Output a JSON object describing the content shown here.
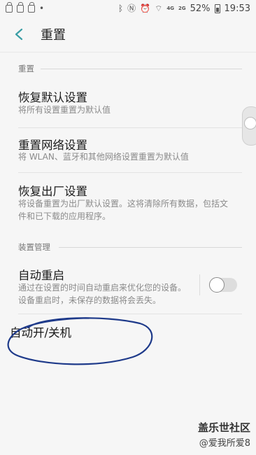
{
  "status_bar": {
    "battery": "52%",
    "time": "19:53",
    "net_a": "4G",
    "net_b": "2G"
  },
  "header": {
    "title": "重置"
  },
  "sections": [
    {
      "label": "重置",
      "items": [
        {
          "title": "恢复默认设置",
          "desc": "将所有设置重置为默认值"
        },
        {
          "title": "重置网络设置",
          "desc": "将 WLAN、蓝牙和其他网络设置重置为默认值"
        },
        {
          "title": "恢复出厂设置",
          "desc": "将设备重置为出厂默认设置。这将清除所有数据，包括文件和已下载的应用程序。"
        }
      ]
    },
    {
      "label": "装置管理",
      "items": [
        {
          "title": "自动重启",
          "desc": "通过在设置的时间自动重启来优化您的设备。设备重启时，未保存的数据将会丢失。",
          "toggle_on": false
        },
        {
          "title": "自动开/关机"
        }
      ]
    }
  ],
  "watermark": {
    "logo": "盖乐世社区",
    "user": "@爱我所爱8"
  },
  "colors": {
    "accent": "#3a9ea5",
    "scribble": "#1e3a8a"
  }
}
